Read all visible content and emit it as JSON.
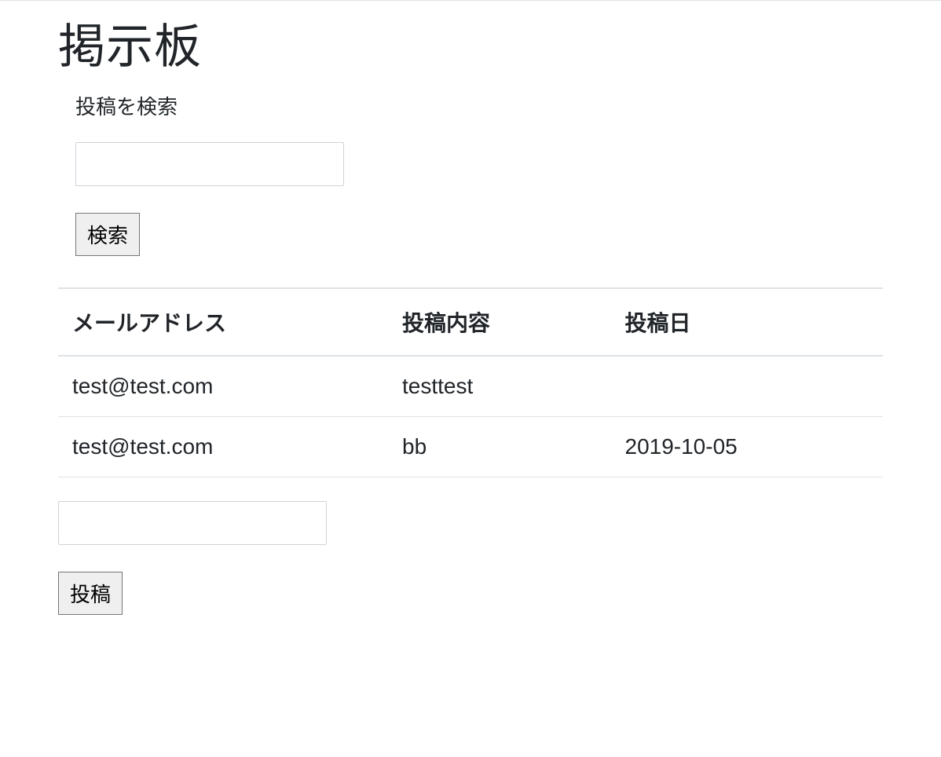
{
  "page": {
    "title": "掲示板"
  },
  "search": {
    "label": "投稿を検索",
    "input_value": "",
    "button_label": "検索"
  },
  "table": {
    "headers": {
      "email": "メールアドレス",
      "content": "投稿内容",
      "date": "投稿日"
    },
    "rows": [
      {
        "email": "test@test.com",
        "content": "testtest",
        "date": ""
      },
      {
        "email": "test@test.com",
        "content": "bb",
        "date": "2019-10-05"
      }
    ]
  },
  "post": {
    "input_value": "",
    "button_label": "投稿"
  }
}
